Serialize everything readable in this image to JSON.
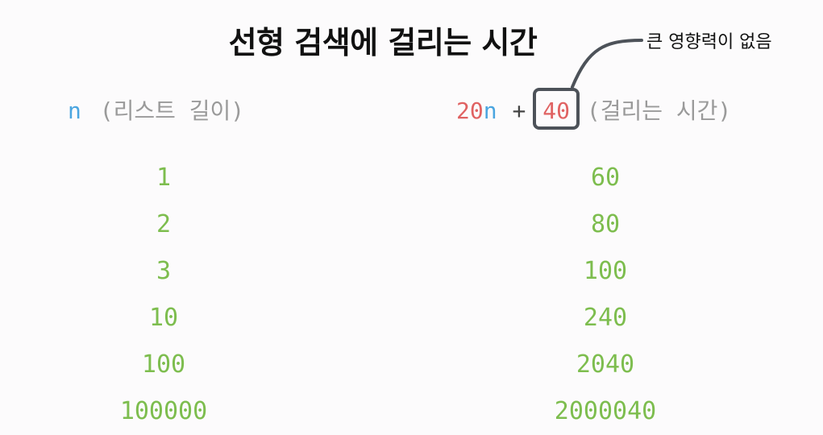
{
  "title": "선형 검색에 걸리는 시간",
  "annotation": "큰 영향력이 없음",
  "header_left": {
    "variable": "n",
    "label": "(리스트 길이)"
  },
  "header_right": {
    "coefficient": "20",
    "variable": "n",
    "operator": "+",
    "constant": "40",
    "label": "(걸리는 시간)"
  },
  "rows": [
    {
      "n": "1",
      "time": "60"
    },
    {
      "n": "2",
      "time": "80"
    },
    {
      "n": "3",
      "time": "100"
    },
    {
      "n": "10",
      "time": "240"
    },
    {
      "n": "100",
      "time": "2040"
    },
    {
      "n": "100000",
      "time": "2000040"
    }
  ],
  "colors": {
    "variable": "#4aa5e0",
    "coefficient": "#e06262",
    "values": "#7dbd4e",
    "label": "#9a9a9a",
    "box": "#4d5259"
  }
}
